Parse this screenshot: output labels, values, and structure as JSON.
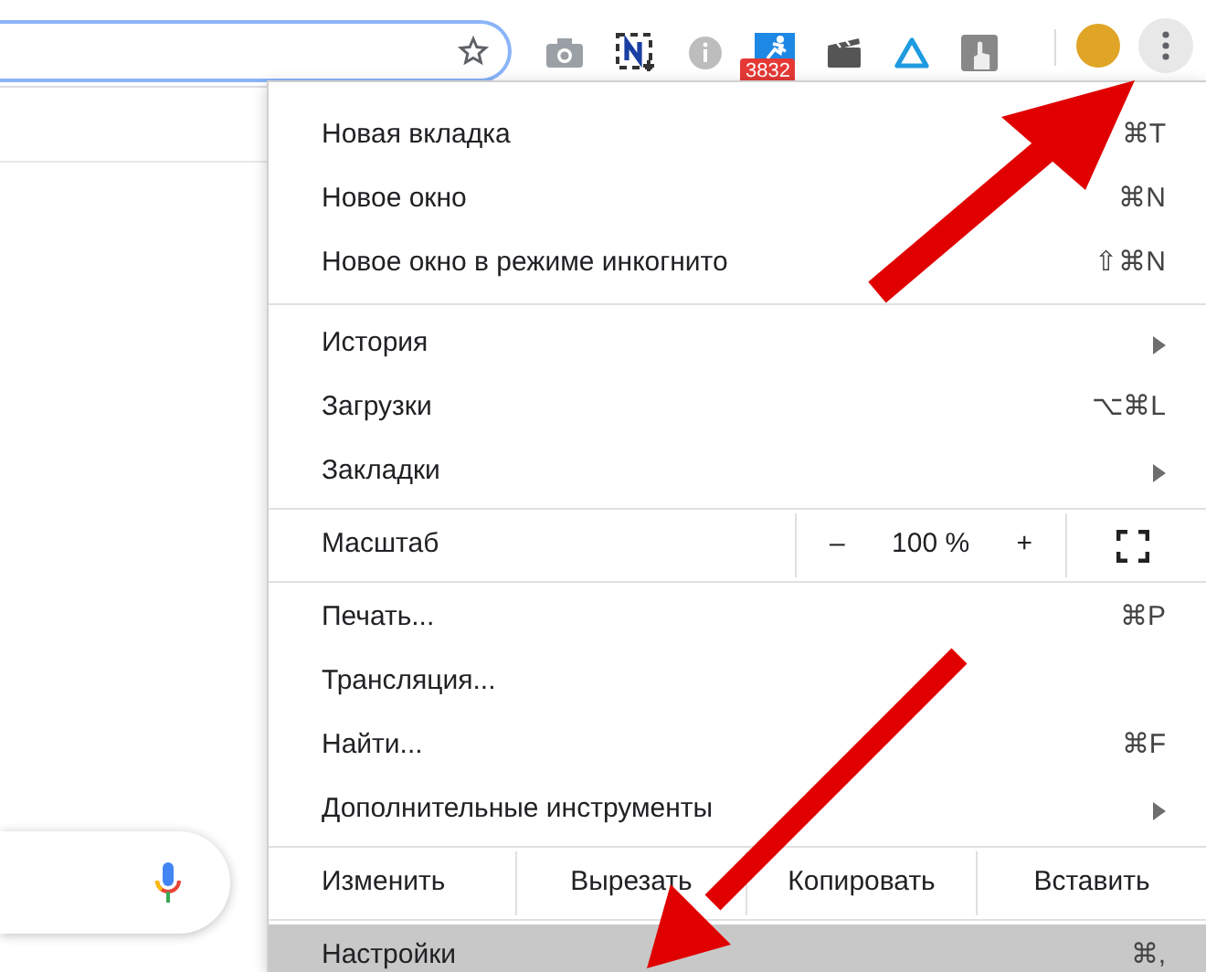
{
  "toolbar": {
    "extension_badge": "3832"
  },
  "menu": {
    "sections": [
      [
        {
          "kind": "item",
          "label": "Новая вкладка",
          "shortcut": "⌘T",
          "selected": false
        },
        {
          "kind": "item",
          "label": "Новое окно",
          "shortcut": "⌘N",
          "selected": false
        },
        {
          "kind": "item",
          "label": "Новое окно в режиме инкогнито",
          "shortcut": "⇧⌘N",
          "selected": false
        }
      ],
      [
        {
          "kind": "submenu",
          "label": "История",
          "selected": false
        },
        {
          "kind": "item",
          "label": "Загрузки",
          "shortcut": "⌥⌘L",
          "selected": false
        },
        {
          "kind": "submenu",
          "label": "Закладки",
          "selected": false
        }
      ],
      [
        {
          "kind": "zoom",
          "label": "Масштаб",
          "minus": "–",
          "value": "100 %",
          "plus": "+"
        }
      ],
      [
        {
          "kind": "item",
          "label": "Печать...",
          "shortcut": "⌘P",
          "selected": false
        },
        {
          "kind": "item",
          "label": "Трансляция...",
          "selected": false
        },
        {
          "kind": "item",
          "label": "Найти...",
          "shortcut": "⌘F",
          "selected": false
        },
        {
          "kind": "submenu",
          "label": "Дополнительные инструменты",
          "selected": false
        }
      ],
      [
        {
          "kind": "edit",
          "label": "Изменить",
          "buttons": [
            "Вырезать",
            "Копировать",
            "Вставить"
          ]
        }
      ],
      [
        {
          "kind": "item",
          "label": "Настройки",
          "shortcut": "⌘,",
          "selected": true
        }
      ]
    ]
  }
}
